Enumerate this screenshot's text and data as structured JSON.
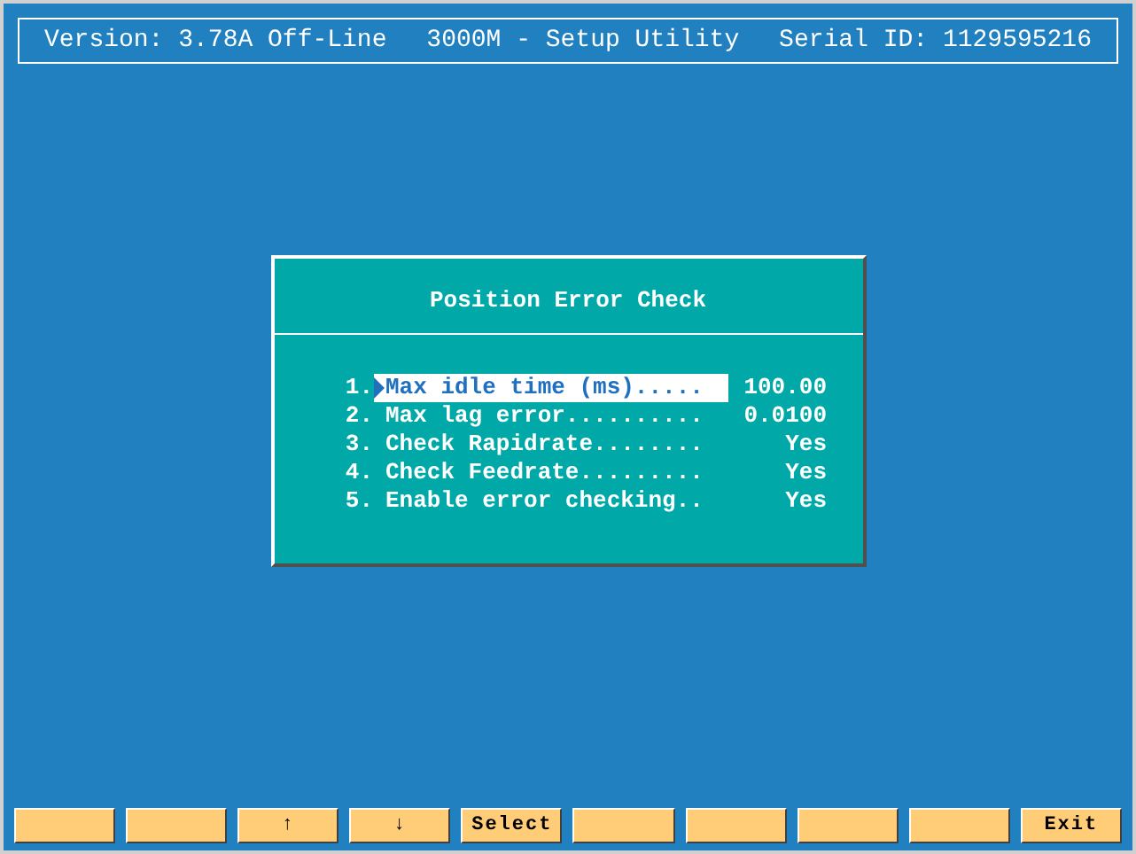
{
  "header": {
    "version": "Version: 3.78A Off-Line",
    "title": "3000M - Setup Utility",
    "serial": "Serial ID: 1129595216"
  },
  "dialog": {
    "title": "Position Error Check",
    "items": [
      {
        "number": "1.",
        "label": "Max idle time (ms).....",
        "value": "100.00",
        "selected": true
      },
      {
        "number": "2.",
        "label": "Max lag error..........",
        "value": "0.0100",
        "selected": false
      },
      {
        "number": "3.",
        "label": "Check Rapidrate........",
        "value": "Yes",
        "selected": false
      },
      {
        "number": "4.",
        "label": "Check Feedrate.........",
        "value": "Yes",
        "selected": false
      },
      {
        "number": "5.",
        "label": "Enable error checking..",
        "value": "Yes",
        "selected": false
      }
    ]
  },
  "function_keys": [
    {
      "kind": "empty"
    },
    {
      "kind": "empty"
    },
    {
      "kind": "key",
      "label": "↑"
    },
    {
      "kind": "key",
      "label": "↓"
    },
    {
      "kind": "key",
      "label": "Select"
    },
    {
      "kind": "empty"
    },
    {
      "kind": "empty"
    },
    {
      "kind": "empty"
    },
    {
      "kind": "empty"
    },
    {
      "kind": "key",
      "label": "Exit"
    }
  ]
}
